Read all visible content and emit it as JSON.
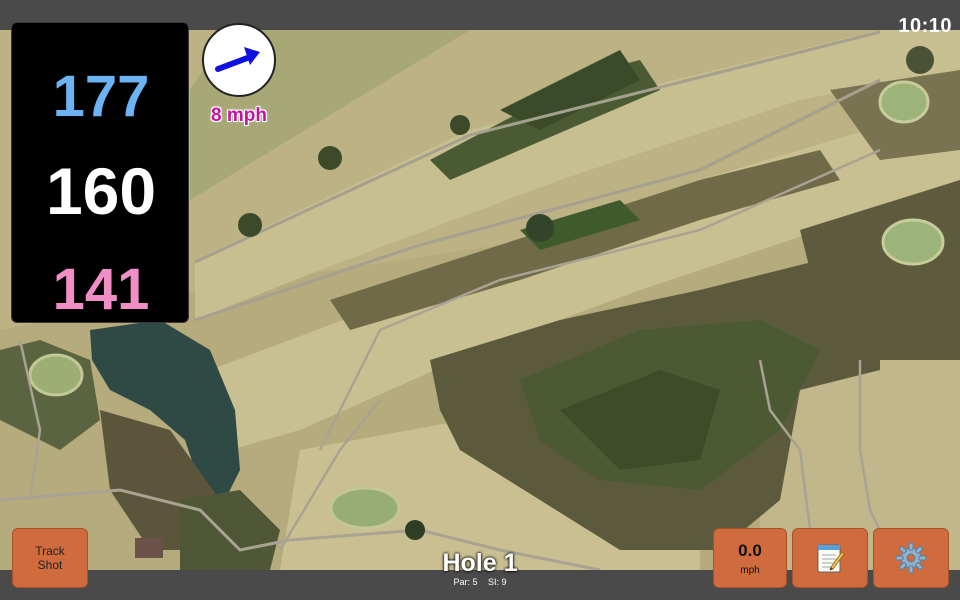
{
  "clock": "10:10",
  "distances": {
    "back": "177",
    "center": "160",
    "front": "141"
  },
  "wind": {
    "speed": "8 mph",
    "direction_icon": "wind-arrow-icon"
  },
  "hole": {
    "title": "Hole 1",
    "par": "Par: 5",
    "si": "SI: 9"
  },
  "buttons": {
    "track_line1": "Track",
    "track_line2": "Shot",
    "speed_value": "0.0",
    "speed_unit": "mph",
    "notes_icon": "notepad-icon",
    "settings_icon": "gear-icon"
  },
  "colors": {
    "back_distance": "#6cb3f3",
    "center_distance": "#ffffff",
    "front_distance": "#f08ec6",
    "button_orange": "#cf6b3c",
    "wind_text": "#c0159e"
  }
}
